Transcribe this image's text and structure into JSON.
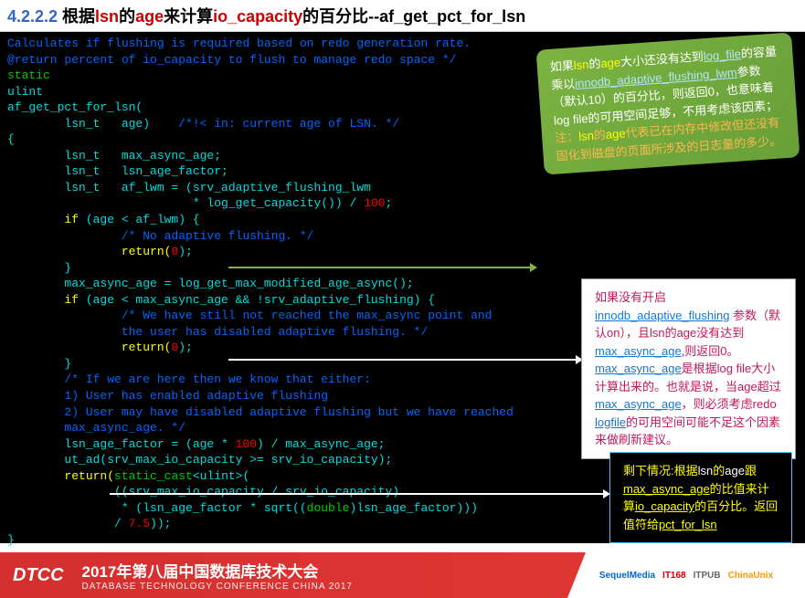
{
  "title": {
    "num": "4.2.2.2 ",
    "zh1": "根据",
    "k1": "lsn",
    "zh2": "的",
    "k2": "age",
    "zh3": "来计算",
    "k3": "io_capacity",
    "zh4": "的百分比",
    "fn": "--af_get_pct_for_lsn"
  },
  "code": {
    "l1": "Calculates if flushing is required based on redo generation rate.",
    "l2": "@return percent of io_capacity to flush to manage redo space */",
    "l3": "static",
    "l4": "ulint",
    "l5": "af_get_pct_for_lsn(",
    "l6a": "        lsn_t   age)    ",
    "l6b": "/*!< in: current age of LSN. */",
    "l7": "{",
    "l8": "        lsn_t   max_async_age;",
    "l9": "        lsn_t   lsn_age_factor;",
    "l10a": "        lsn_t   af_lwm = (srv_adaptive_flushing_lwm",
    "l11a": "                          * log_get_capacity()) / ",
    "l11b": "100",
    "l11c": ";",
    "l12a": "        if",
    "l12b": " (age < af_lwm) {",
    "l13": "                /* No adaptive flushing. */",
    "l14a": "                return(",
    "l14b": "0",
    "l14c": ");",
    "l15": "        }",
    "l16": "        max_async_age = log_get_max_modified_age_async();",
    "l17a": "        if",
    "l17b": " (age < max_async_age && !srv_adaptive_flushing) {",
    "l18": "                /* We have still not reached the max_async point and",
    "l19": "                the user has disabled adaptive flushing. */",
    "l20a": "                return(",
    "l20b": "0",
    "l20c": ");",
    "l21": "        }",
    "l22": "        /* If we are here then we know that either:",
    "l23": "        1) User has enabled adaptive flushing",
    "l24": "        2) User may have disabled adaptive flushing but we have reached",
    "l25": "        max_async_age. */",
    "l26a": "        lsn_age_factor = (age * ",
    "l26b": "100",
    "l26c": ") / max_async_age;",
    "l27": "        ut_ad(srv_max_io_capacity >= srv_io_capacity);",
    "l28a": "        return(",
    "l28b": "static_cast",
    "l28c": "<ulint>(",
    "l29": "               ((srv_max_io_capacity / srv_io_capacity)",
    "l30a": "                * (lsn_age_factor * sqrt((",
    "l30b": "double",
    "l30c": ")lsn_age_factor)))",
    "l31a": "               / ",
    "l31b": "7.5",
    "l31c": "));",
    "l32": "}"
  },
  "c1": {
    "t1": "如果",
    "k1": "lsn",
    "t2": "的",
    "k2": "age",
    "t3": "大小还没有达到",
    "u1": "log_file",
    "t4": "的容量乘以",
    "u2": "innodb_adaptive_flushing_lwm",
    "t5": "参数（默认10）的百分比，则返回0，也意味着log file的可用空间足够，不用考虑该因素；",
    "t6": "注：",
    "k3": "lsn",
    "t7": "的",
    "k4": "age",
    "t8": "代表已在内存中修改但还没有固化到磁盘的页面所涉及的日志量的多少。"
  },
  "c2": {
    "t1": "如果没有开启",
    "u1": "innodb_adaptive_flushing",
    "t2": " 参数（默认on），且lsn的age没有达到",
    "u2": "max_async_age",
    "t3": ",则返回0。",
    "u3": "max_async_age",
    "t4": "是根据log file大小计算出来的。也就是说，当age超过",
    "u4": "max_async_age",
    "t5": "，则必须考虑redo ",
    "u5": "logfile",
    "t6": "的可用空间可能不足这个因素来做刷新建议。"
  },
  "c3": {
    "t1": "剩下情况:根据",
    "k1": "lsn",
    "t2": "的",
    "k2": "age",
    "t3": "跟",
    "u1": "max_async_age",
    "t4": "的比值来计算",
    "u2": "io_capacity",
    "t5": "的百分比。返回值符给",
    "u3": "pct_for_lsn"
  },
  "footer": {
    "logo": "DTCC",
    "title": "2017年第八届中国数据库技术大会",
    "sub": "DATABASE TECHNOLOGY CONFERENCE CHINA 2017",
    "s1": "SequelMedia",
    "s2": "IT168",
    "s3": "ITPUB",
    "s4": "ChinaUnix"
  }
}
